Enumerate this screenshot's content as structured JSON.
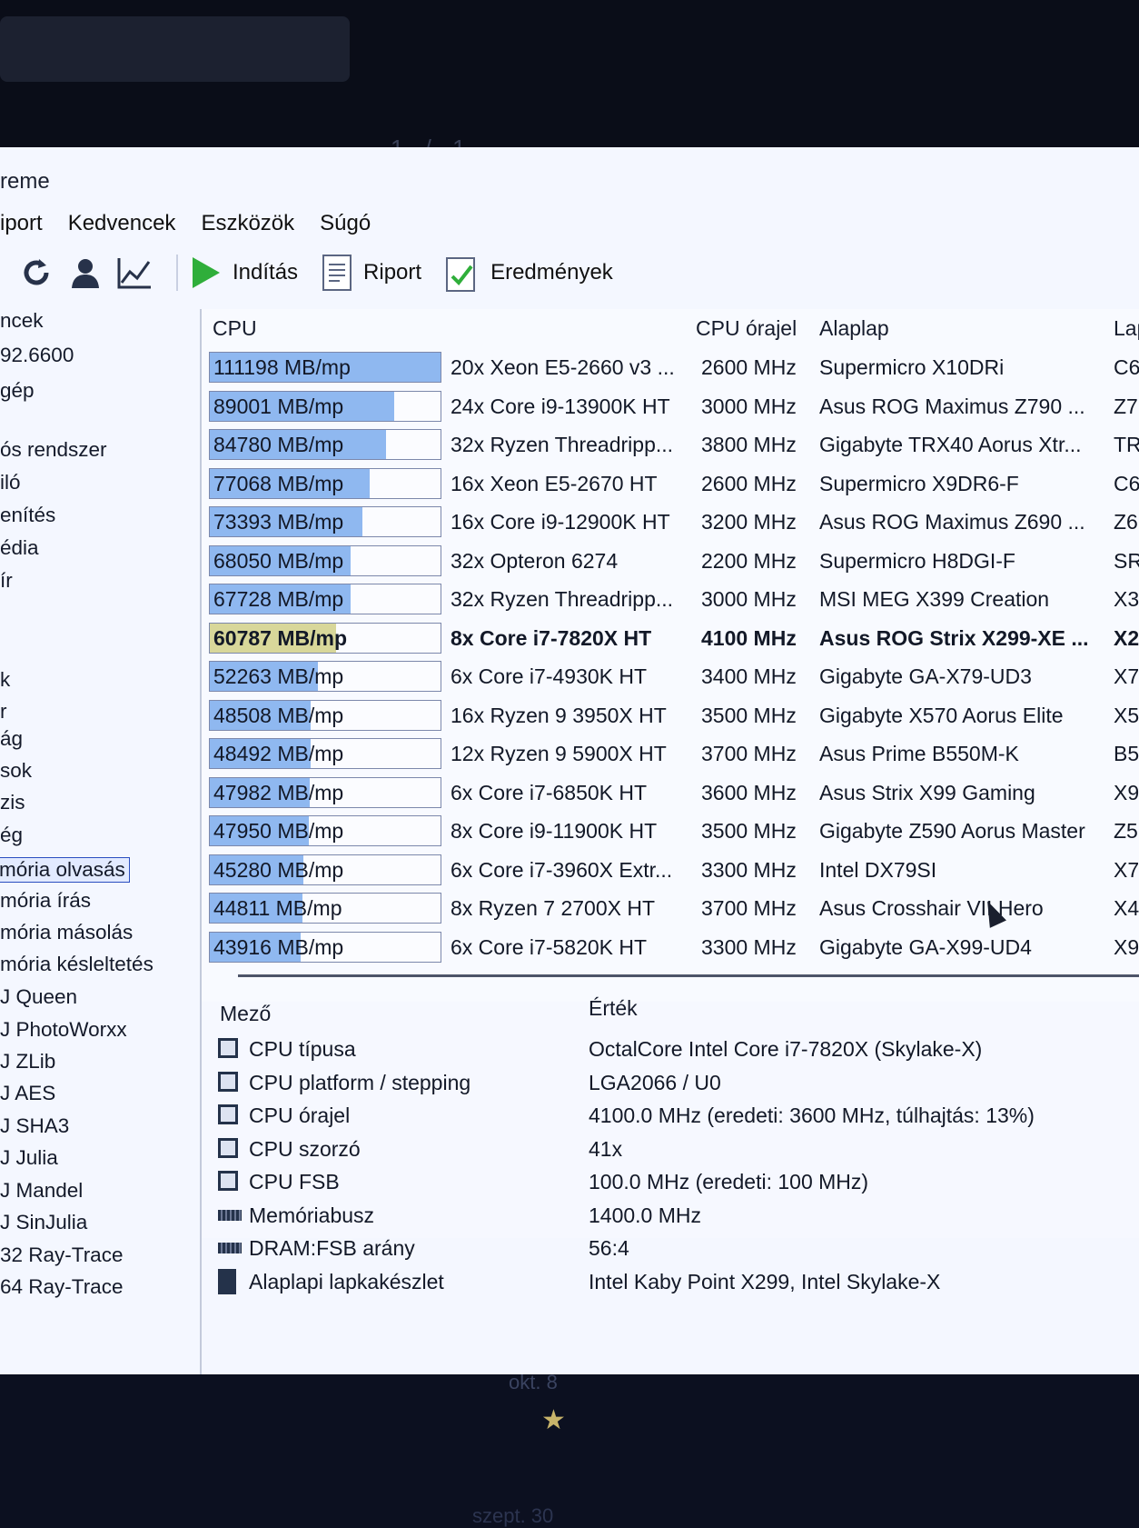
{
  "background": {
    "pager": "1 / 1",
    "date_1": "okt. 8",
    "date_2": "szept. 30",
    "star_icon": "star-icon"
  },
  "window": {
    "title": "reme",
    "menu": [
      "iport",
      "Kedvencek",
      "Eszközök",
      "Súgó"
    ],
    "toolbar": {
      "start": "Indítás",
      "report": "Riport",
      "results": "Eredmények"
    },
    "colors": {
      "bar": "#8fb8f0",
      "bar_highlight": "#d8d79a",
      "selection": "#2a4ec0"
    }
  },
  "sidebar": {
    "items": [
      "ncek",
      "92.6600",
      "gép",
      "",
      "ós rendszer",
      "iló",
      "enítés",
      "édia",
      "ír",
      "",
      "",
      "k",
      "r",
      "ág",
      "sok",
      "zis",
      "ég",
      "mória olvasás",
      "mória írás",
      "mória másolás",
      "mória késleltetés",
      "J Queen",
      "J PhotoWorxx",
      "J ZLib",
      "J AES",
      "J SHA3",
      "J Julia",
      "J Mandel",
      "J SinJulia",
      "32 Ray-Trace",
      "64 Ray-Trace"
    ],
    "selected_index": 17
  },
  "table": {
    "headers": {
      "cpu": "CPU",
      "clock": "CPU órajel",
      "board": "Alaplap",
      "chipset": "Lap"
    },
    "bar_max": 111198,
    "rows": [
      {
        "score": "111198 MB/mp",
        "value": 111198,
        "cpu": "20x Xeon E5-2660 v3 ...",
        "clock": "2600 MHz",
        "board": "Supermicro X10DRi",
        "chip": "C6"
      },
      {
        "score": "89001 MB/mp",
        "value": 89001,
        "cpu": "24x Core i9-13900K HT",
        "clock": "3000 MHz",
        "board": "Asus ROG Maximus Z790 ...",
        "chip": "Z7"
      },
      {
        "score": "84780 MB/mp",
        "value": 84780,
        "cpu": "32x Ryzen Threadripp...",
        "clock": "3800 MHz",
        "board": "Gigabyte TRX40 Aorus Xtr...",
        "chip": "TR"
      },
      {
        "score": "77068 MB/mp",
        "value": 77068,
        "cpu": "16x Xeon E5-2670 HT",
        "clock": "2600 MHz",
        "board": "Supermicro X9DR6-F",
        "chip": "C6"
      },
      {
        "score": "73393 MB/mp",
        "value": 73393,
        "cpu": "16x Core i9-12900K HT",
        "clock": "3200 MHz",
        "board": "Asus ROG Maximus Z690 ...",
        "chip": "Z6"
      },
      {
        "score": "68050 MB/mp",
        "value": 68050,
        "cpu": "32x Opteron 6274",
        "clock": "2200 MHz",
        "board": "Supermicro H8DGI-F",
        "chip": "SR"
      },
      {
        "score": "67728 MB/mp",
        "value": 67728,
        "cpu": "32x Ryzen Threadripp...",
        "clock": "3000 MHz",
        "board": "MSI MEG X399 Creation",
        "chip": "X3"
      },
      {
        "score": "60787 MB/mp",
        "value": 60787,
        "cpu": "8x Core i7-7820X HT",
        "clock": "4100 MHz",
        "board": "Asus ROG Strix X299-XE ...",
        "chip": "X2",
        "current": true
      },
      {
        "score": "52263 MB/mp",
        "value": 52263,
        "cpu": "6x Core i7-4930K HT",
        "clock": "3400 MHz",
        "board": "Gigabyte GA-X79-UD3",
        "chip": "X7"
      },
      {
        "score": "48508 MB/mp",
        "value": 48508,
        "cpu": "16x Ryzen 9 3950X HT",
        "clock": "3500 MHz",
        "board": "Gigabyte X570 Aorus Elite",
        "chip": "X5"
      },
      {
        "score": "48492 MB/mp",
        "value": 48492,
        "cpu": "12x Ryzen 9 5900X HT",
        "clock": "3700 MHz",
        "board": "Asus Prime B550M-K",
        "chip": "B5"
      },
      {
        "score": "47982 MB/mp",
        "value": 47982,
        "cpu": "6x Core i7-6850K HT",
        "clock": "3600 MHz",
        "board": "Asus Strix X99 Gaming",
        "chip": "X9"
      },
      {
        "score": "47950 MB/mp",
        "value": 47950,
        "cpu": "8x Core i9-11900K HT",
        "clock": "3500 MHz",
        "board": "Gigabyte Z590 Aorus Master",
        "chip": "Z5"
      },
      {
        "score": "45280 MB/mp",
        "value": 45280,
        "cpu": "6x Core i7-3960X Extr...",
        "clock": "3300 MHz",
        "board": "Intel DX79SI",
        "chip": "X7"
      },
      {
        "score": "44811 MB/mp",
        "value": 44811,
        "cpu": "8x Ryzen 7 2700X HT",
        "clock": "3700 MHz",
        "board": "Asus Crosshair VII Hero",
        "chip": "X4"
      },
      {
        "score": "43916 MB/mp",
        "value": 43916,
        "cpu": "6x Core i7-5820K HT",
        "clock": "3300 MHz",
        "board": "Gigabyte GA-X99-UD4",
        "chip": "X9"
      }
    ]
  },
  "details": {
    "headers": {
      "field": "Mező",
      "value": "Érték"
    },
    "rows": [
      {
        "icon": "cpu-icon",
        "field": "CPU típusa",
        "value": "OctalCore Intel Core i7-7820X  (Skylake-X)"
      },
      {
        "icon": "cpu-icon",
        "field": "CPU platform / stepping",
        "value": "LGA2066 / U0"
      },
      {
        "icon": "cpu-icon",
        "field": "CPU órajel",
        "value": "4100.0 MHz  (eredeti: 3600 MHz, túlhajtás: 13%)"
      },
      {
        "icon": "cpu-icon",
        "field": "CPU szorzó",
        "value": "41x"
      },
      {
        "icon": "cpu-icon",
        "field": "CPU FSB",
        "value": "100.0 MHz  (eredeti: 100 MHz)"
      },
      {
        "icon": "memory-icon",
        "field": "Memóriabusz",
        "value": "1400.0 MHz"
      },
      {
        "icon": "memory-icon",
        "field": "DRAM:FSB arány",
        "value": "56:4"
      },
      {
        "icon": "chipset-icon",
        "field": "Alaplapi lapkakészlet",
        "value": "Intel Kaby Point X299, Intel Skylake-X"
      }
    ]
  }
}
